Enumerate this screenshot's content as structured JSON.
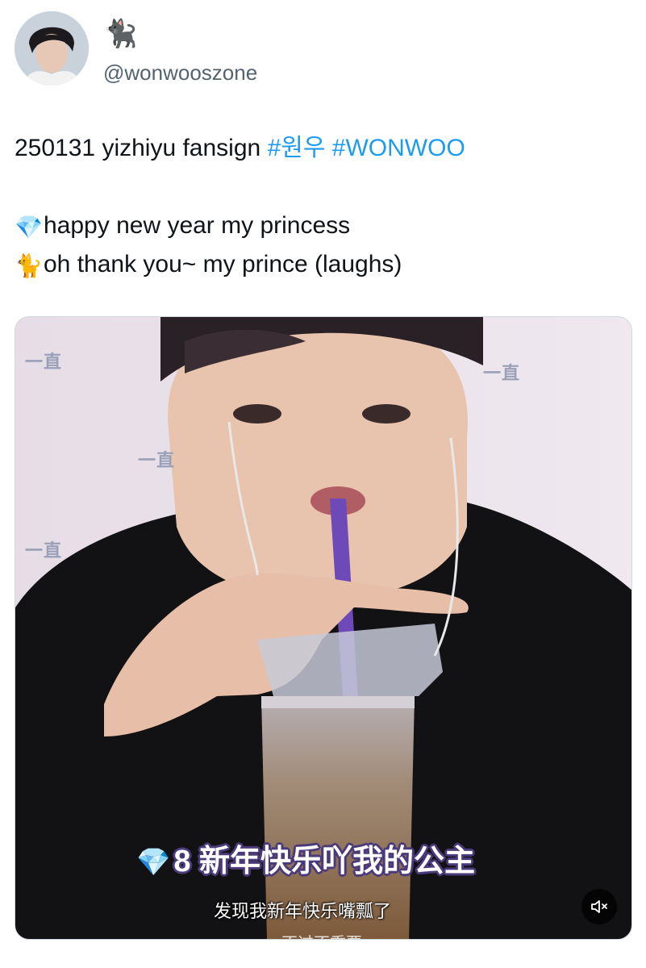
{
  "header": {
    "display_name_emoji": "🐈‍⬛",
    "handle": "@wonwooszone",
    "avatar_icon": "profile-avatar"
  },
  "tweet": {
    "line1_text": "250131 yizhiyu fansign ",
    "hashtag1": "#원우",
    "hashtag2": "#WONWOO",
    "line2_emoji": "💎",
    "line2_text": "happy new year my princess",
    "line3_emoji": "🐈",
    "line3_text": "oh thank you~ my prince (laughs)"
  },
  "media": {
    "watermark": "一直",
    "subtitle_main": "新年快乐吖我的公主",
    "subtitle_main_emoji": "💎",
    "subtitle_main_marker": "8",
    "subtitle_small": "发现我新年快乐嘴瓢了",
    "subtitle_cut": "不过不重要",
    "mute_icon": "volume-muted-icon"
  },
  "colors": {
    "hashtag": "#1d9bf0",
    "handle": "#536471",
    "text": "#0f1419"
  }
}
